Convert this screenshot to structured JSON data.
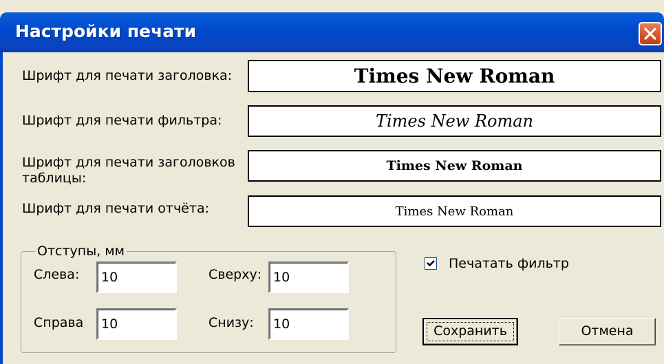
{
  "window": {
    "title": "Настройки печати",
    "close_icon": "close-icon"
  },
  "fonts": {
    "header_label": "Шрифт для печати заголовка:",
    "header_value": "Times New Roman",
    "filter_label": "Шрифт для печати фильтра:",
    "filter_value": "Times New Roman",
    "table_headers_label_line1": "Шрифт для печати заголовков",
    "table_headers_label_line2": "таблицы:",
    "table_headers_value": "Times New Roman",
    "report_label": "Шрифт для печати отчёта:",
    "report_value": "Times New Roman"
  },
  "margins": {
    "legend": "Отступы, мм",
    "left_label": "Слева:",
    "left_value": "10",
    "top_label": "Сверху:",
    "top_value": "10",
    "right_label": "Справа",
    "right_value": "10",
    "bottom_label": "Снизу:",
    "bottom_value": "10"
  },
  "print_filter": {
    "label": "Печатать фильтр",
    "checked": true
  },
  "buttons": {
    "save": "Сохранить",
    "cancel": "Отмена"
  }
}
